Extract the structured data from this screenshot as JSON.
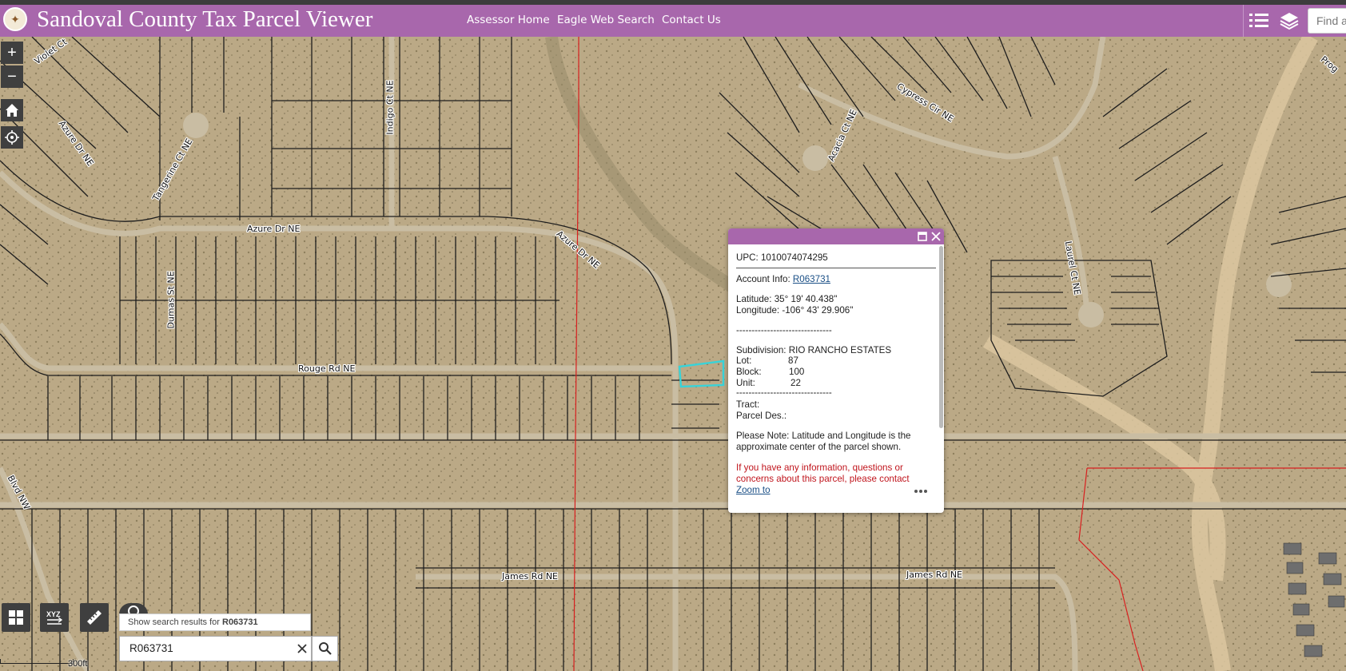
{
  "header": {
    "title": "Sandoval County Tax Parcel Viewer",
    "logo_icon": "county-seal",
    "nav": [
      "Assessor Home",
      "Eagle Web Search",
      "Contact Us"
    ],
    "find_placeholder": "Find a"
  },
  "colors": {
    "brand": "#a867ac",
    "selected_parcel": "#39d3d8",
    "boundary": "#d81f1f",
    "parcel_lines": "#1d1d1d",
    "alert_text": "#c0141c"
  },
  "map": {
    "road_labels": [
      "Violet Ct",
      "Azure Dr NE",
      "Tangerine Ct NE",
      "Indigo Ct NE",
      "Azure Dr NE",
      "Azure Dr NE",
      "Dumas St NE",
      "Rouge Rd NE",
      "Acacia Ct NE",
      "Cypress Cir NE",
      "Laurel Ct NE",
      "Prog",
      "Blvd NW",
      "James Rd NE",
      "James Rd NE"
    ],
    "scale_label": "300ft"
  },
  "popup": {
    "upc_label": "UPC:",
    "upc": "1010074074295",
    "account_label": "Account Info:",
    "account": "R063731",
    "latitude": "Latitude: 35° 19' 40.438\"",
    "longitude": "Longitude: -106° 43' 29.906\"",
    "divider": "-------------------------------",
    "subdivision": "Subdivision: RIO RANCHO ESTATES",
    "lot_label": "Lot:",
    "lot": "87",
    "block_label": "Block:",
    "block": "100",
    "unit_label": "Unit:",
    "unit": "22",
    "tract": "Tract:",
    "parcel_des": "Parcel Des.:",
    "note_line1": "Please Note: Latitude and Longitude is the",
    "note_line2": "approximate center of the parcel shown.",
    "alert_line1": "If you have any information, questions or",
    "alert_line2": "concerns about this parcel, please contact",
    "zoom_to": "Zoom to",
    "more_icon": "more-dots",
    "maximize_icon": "maximize-icon",
    "close_icon": "close-icon"
  },
  "search": {
    "tip_prefix": "Show search results for ",
    "tip_term": "R063731",
    "value": "R063731"
  },
  "controls": {
    "zoom_in": "+",
    "zoom_out": "−",
    "tool_icons": [
      "widget-grid",
      "coordinate-xyz",
      "measure-ruler",
      "search"
    ]
  }
}
